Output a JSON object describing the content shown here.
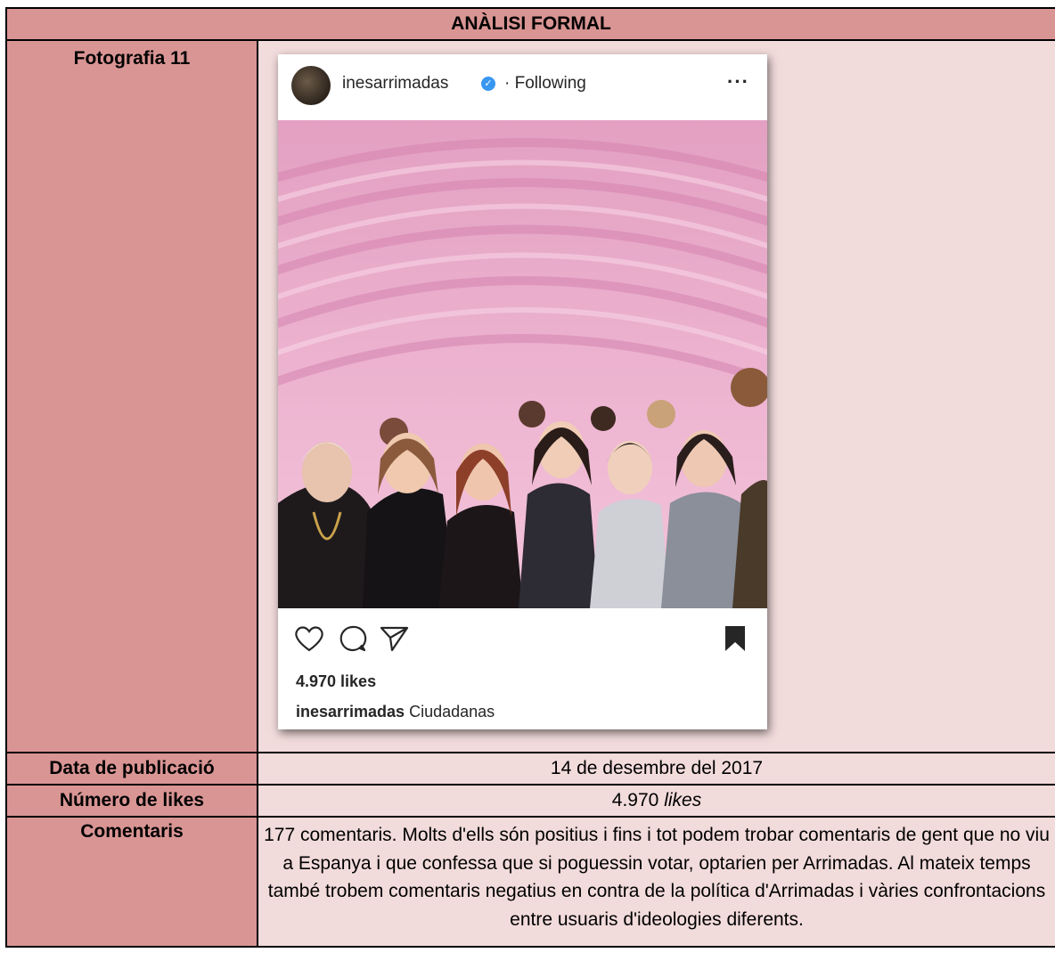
{
  "header": {
    "title": "ANÀLISI FORMAL"
  },
  "photo_row": {
    "label": "Fotografia 11"
  },
  "post": {
    "username": "inesarrimadas",
    "separator": "·",
    "follow_status": "Following",
    "more": "···",
    "likes": "4.970 likes",
    "caption_user": "inesarrimadas",
    "caption_text": "Ciudadanas",
    "icons": [
      "heart-icon",
      "comment-icon",
      "share-icon",
      "bookmark-icon",
      "verified-badge-icon"
    ]
  },
  "rows": {
    "date": {
      "label": "Data de publicació",
      "value": "14 de desembre del 2017"
    },
    "likes": {
      "label": "Número de likes",
      "value_number": "4.970",
      "value_unit": "likes"
    },
    "comments": {
      "label": "Comentaris",
      "value": "177 comentaris.  Molts d'ells són positius i fins i tot podem trobar comentaris de gent que no viu a Espanya i que confessa que si poguessin votar, optarien per Arrimadas. Al mateix temps també trobem comentaris negatius en contra de la política d'Arrimadas i vàries confrontacions entre usuaris d'ideologies diferents."
    }
  },
  "colors": {
    "label_bg": "#d99594",
    "value_bg": "#f2dbdb",
    "header_bg": "#d99594"
  }
}
